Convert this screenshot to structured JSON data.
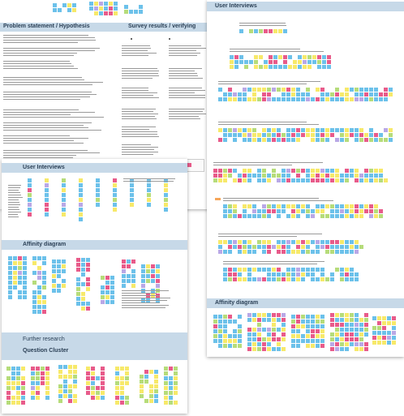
{
  "colors": {
    "header_band": "#c7d9e8",
    "header_text": "#2a3f55",
    "note_yellow": "#f7e96a",
    "note_blue": "#6cc1ea",
    "note_pink": "#e85b8a",
    "note_green": "#b6dc7a",
    "note_purple": "#b9a8e6",
    "note_orange": "#f6a65a"
  },
  "board_a": {
    "title_left": "Problem statement / Hypothesis",
    "title_right": "Survey results / verifying"
  },
  "board_b": {
    "title": "User Interviews",
    "affinity_title": "Affinity diagram",
    "further_title": "Further research",
    "question_title": "Question Cluster"
  },
  "board_c": {
    "title": "User Interviews",
    "affinity_title": "Affinity diagram"
  }
}
